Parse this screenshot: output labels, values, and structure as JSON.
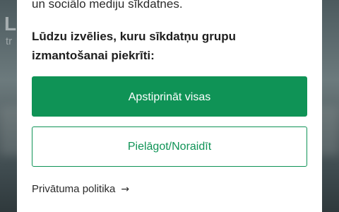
{
  "background": {
    "peek_title": "L",
    "peek_subtitle": "tr"
  },
  "consent_dialog": {
    "intro_tail": "un sociālo mediju sīkdatnes.",
    "prompt": "Lūdzu izvēlies, kuru sīkdatņu grupu izmantošanai piekrīti:",
    "accept_all_label": "Apstiprināt visas",
    "customize_label": "Pielāgot/Noraidīt",
    "privacy_policy_label": "Privātuma politika",
    "privacy_arrow_icon": "arrow-right-icon",
    "colors": {
      "accent": "#0f9356",
      "text": "#1e1e1e"
    }
  }
}
